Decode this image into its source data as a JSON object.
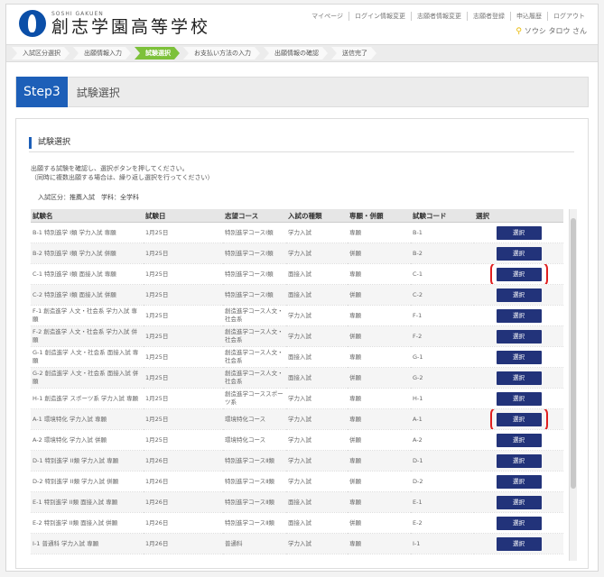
{
  "header": {
    "logo_sub": "SOSHI GAKUEN",
    "school_name": "創志学園高等学校",
    "nav": [
      "マイページ",
      "ログイン情報変更",
      "志願者情報変更",
      "志願者登録",
      "申込履歴",
      "ログアウト"
    ],
    "user_name": "ソウシ タロウ さん"
  },
  "progress": [
    "入試区分選択",
    "出願情報入力",
    "試験選択",
    "お支払い方法の入力",
    "出願情報の確認",
    "送信完了"
  ],
  "step": {
    "badge": "Step3",
    "title": "試験選択"
  },
  "section": {
    "heading": "試験選択",
    "instruction_1": "出願する試験を確認し、選択ボタンを押してください。",
    "instruction_2": "（同時に複数出願する場合は、繰り返し選択を行ってください）",
    "filter": "入試区分：推薦入試　学科：全学科"
  },
  "table": {
    "headers": [
      "試験名",
      "試験日",
      "志望コース",
      "入試の種類",
      "専願・併願",
      "試験コード",
      "選択"
    ],
    "button_label": "選択",
    "rows": [
      {
        "name": "B-1 特別進学 I類 学力入試 専願",
        "date": "1月25日",
        "course": "特別進学コースⅠ類",
        "type": "学力入試",
        "kind": "専願",
        "code": "B-1"
      },
      {
        "name": "B-2 特別進学 I類 学力入試 併願",
        "date": "1月25日",
        "course": "特別進学コースⅠ類",
        "type": "学力入試",
        "kind": "併願",
        "code": "B-2"
      },
      {
        "name": "C-1 特別進学 I類 面接入試 専願",
        "date": "1月25日",
        "course": "特別進学コースⅠ類",
        "type": "面接入試",
        "kind": "専願",
        "code": "C-1"
      },
      {
        "name": "C-2 特別進学 I類 面接入試 併願",
        "date": "1月25日",
        "course": "特別進学コースⅠ類",
        "type": "面接入試",
        "kind": "併願",
        "code": "C-2"
      },
      {
        "name": "F-1 創造進学 人文・社会系 学力入試 専願",
        "date": "1月25日",
        "course": "創造進学コース人文・社会系",
        "type": "学力入試",
        "kind": "専願",
        "code": "F-1"
      },
      {
        "name": "F-2 創造進学 人文・社会系 学力入試 併願",
        "date": "1月25日",
        "course": "創造進学コース人文・社会系",
        "type": "学力入試",
        "kind": "併願",
        "code": "F-2"
      },
      {
        "name": "G-1 創造進学 人文・社会系 面接入試 専願",
        "date": "1月25日",
        "course": "創造進学コース人文・社会系",
        "type": "面接入試",
        "kind": "専願",
        "code": "G-1"
      },
      {
        "name": "G-2 創造進学 人文・社会系 面接入試 併願",
        "date": "1月25日",
        "course": "創造進学コース人文・社会系",
        "type": "面接入試",
        "kind": "併願",
        "code": "G-2"
      },
      {
        "name": "H-1 創造進学 スポーツ系 学力入試 専願",
        "date": "1月25日",
        "course": "創造進学コーススポーツ系",
        "type": "学力入試",
        "kind": "専願",
        "code": "H-1"
      },
      {
        "name": "A-1 環境特化 学力入試 専願",
        "date": "1月25日",
        "course": "環境特化コース",
        "type": "学力入試",
        "kind": "専願",
        "code": "A-1"
      },
      {
        "name": "A-2 環境特化 学力入試 併願",
        "date": "1月25日",
        "course": "環境特化コース",
        "type": "学力入試",
        "kind": "併願",
        "code": "A-2"
      },
      {
        "name": "D-1 特別進学 II類 学力入試 専願",
        "date": "1月26日",
        "course": "特別進学コースⅡ類",
        "type": "学力入試",
        "kind": "専願",
        "code": "D-1"
      },
      {
        "name": "D-2 特別進学 II類 学力入試 併願",
        "date": "1月26日",
        "course": "特別進学コースⅡ類",
        "type": "学力入試",
        "kind": "併願",
        "code": "D-2"
      },
      {
        "name": "E-1 特別進学 II類 面接入試 専願",
        "date": "1月26日",
        "course": "特別進学コースⅡ類",
        "type": "面接入試",
        "kind": "専願",
        "code": "E-1"
      },
      {
        "name": "E-2 特別進学 II類 面接入試 併願",
        "date": "1月26日",
        "course": "特別進学コースⅡ類",
        "type": "面接入試",
        "kind": "併願",
        "code": "E-2"
      },
      {
        "name": "I-1 普通科 学力入試 専願",
        "date": "1月26日",
        "course": "普通科",
        "type": "学力入試",
        "kind": "専願",
        "code": "I-1"
      }
    ],
    "highlighted_rows": [
      2,
      9
    ]
  }
}
